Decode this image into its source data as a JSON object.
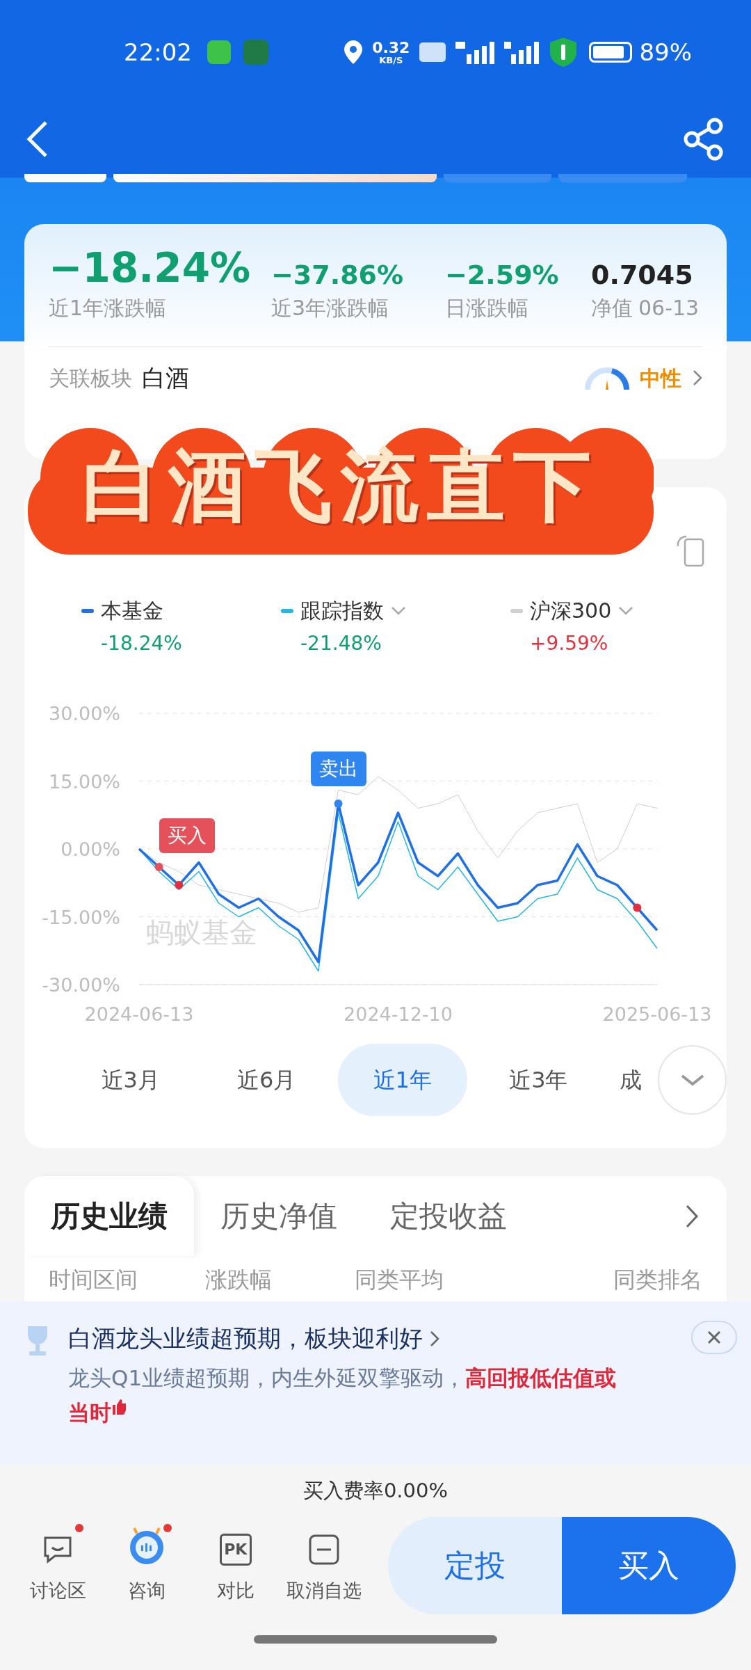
{
  "status_bar": {
    "time": "22:02",
    "speed": "0.32",
    "speed_unit": "KB/S",
    "battery": "89%"
  },
  "summary": {
    "metrics": [
      {
        "value": "−18.24%",
        "label": "近1年涨跌幅",
        "kind": "main",
        "color": "#10a070"
      },
      {
        "value": "−37.86%",
        "label": "近3年涨跌幅",
        "kind": "normal",
        "color": "#10a070"
      },
      {
        "value": "−2.59%",
        "label": "日涨跌幅",
        "kind": "normal",
        "color": "#10a070"
      },
      {
        "value": "0.7045",
        "label": "净值",
        "date": "06-13",
        "kind": "normal",
        "color": "#222222"
      }
    ],
    "sector_label": "关联板块",
    "sector": "白酒",
    "sentiment": "中性"
  },
  "banner": {
    "title": "白酒飞流直下"
  },
  "legend": [
    {
      "value": "-18.24%",
      "kind": "loss",
      "dropdown": false
    },
    {
      "value": "-21.48%",
      "kind": "loss",
      "dropdown": true
    },
    {
      "value": "+9.59%",
      "kind": "gain",
      "dropdown": true
    }
  ],
  "trade_markers": [
    {
      "text": "买入",
      "kind": "buy"
    },
    {
      "text": "卖出",
      "kind": "sell"
    }
  ],
  "chart_watermark": "蚂蚁基金",
  "chart_data": {
    "type": "line",
    "grid": true,
    "categories": [
      "2024-06-13",
      null,
      null,
      null,
      null,
      null,
      null,
      null,
      null,
      null,
      null,
      null,
      null,
      "2024-12-10",
      null,
      null,
      null,
      null,
      null,
      null,
      null,
      null,
      null,
      null,
      null,
      null,
      "2025-06-13"
    ],
    "ylim": [
      -30,
      30
    ],
    "yticks": [
      {
        "value": 30,
        "label": "30.00%"
      },
      {
        "value": 15,
        "label": "15.00%"
      },
      {
        "value": 0,
        "label": "0.00%"
      },
      {
        "value": -15,
        "label": "-15.00%"
      },
      {
        "value": -30,
        "label": "-30.00%"
      }
    ],
    "series": [
      {
        "name": "本基金",
        "color": "#1f6fe5",
        "values": [
          0,
          -4,
          -8,
          -3,
          -10,
          -13,
          -11,
          -15,
          -18,
          -25,
          10,
          -8,
          -3,
          8,
          -3,
          -6,
          -1,
          -8,
          -13,
          -12,
          -8,
          -7,
          1,
          -6,
          -8,
          -13,
          -18
        ]
      },
      {
        "name": "跟踪指数",
        "color": "#20b8e8",
        "values": [
          0,
          -5,
          -9,
          -5,
          -12,
          -15,
          -13,
          -17,
          -20,
          -27,
          8,
          -11,
          -6,
          6,
          -6,
          -9,
          -4,
          -10,
          -16,
          -15,
          -11,
          -10,
          -2,
          -9,
          -11,
          -16,
          -22
        ]
      },
      {
        "name": "沪深300",
        "color": "#cfcfcf",
        "values": [
          0,
          -3,
          -5,
          -8,
          -9,
          -10,
          -11,
          -12,
          -14,
          -13,
          13,
          12,
          16,
          13,
          9,
          10,
          12,
          4,
          -2,
          4,
          8,
          9,
          10,
          -3,
          0,
          10,
          9
        ]
      }
    ]
  },
  "ranges": [
    {
      "label": "近3月",
      "selected": false
    },
    {
      "label": "近6月",
      "selected": false
    },
    {
      "label": "近1年",
      "selected": true
    },
    {
      "label": "近3年",
      "selected": false
    },
    {
      "label": "成",
      "selected": false
    }
  ],
  "history": {
    "tabs": [
      {
        "label": "历史业绩",
        "selected": true
      },
      {
        "label": "历史净值",
        "selected": false
      },
      {
        "label": "定投收益",
        "selected": false
      }
    ],
    "columns": [
      "时间区间",
      "涨跌幅",
      "同类平均",
      "同类排名"
    ]
  },
  "notice": {
    "title": "白酒龙头业绩超预期，板块迎利好",
    "body": "龙头Q1业绩超预期，内生外延双擎驱动，",
    "highlight": "高回报低估值或",
    "highlight_continued": "当时"
  },
  "fee": "买入费率0.00%",
  "bottom_actions": [
    {
      "label": "讨论区",
      "kind": "chat",
      "badge": true
    },
    {
      "label": "咨询",
      "kind": "assistant",
      "badge": true
    },
    {
      "label": "对比",
      "kind": "compare",
      "icon_text": "PK",
      "badge": false
    },
    {
      "label": "取消自选",
      "kind": "unfollow",
      "badge": false
    }
  ],
  "buttons": [
    {
      "label": "定投",
      "kind": "secondary"
    },
    {
      "label": "买入",
      "kind": "primary"
    }
  ]
}
